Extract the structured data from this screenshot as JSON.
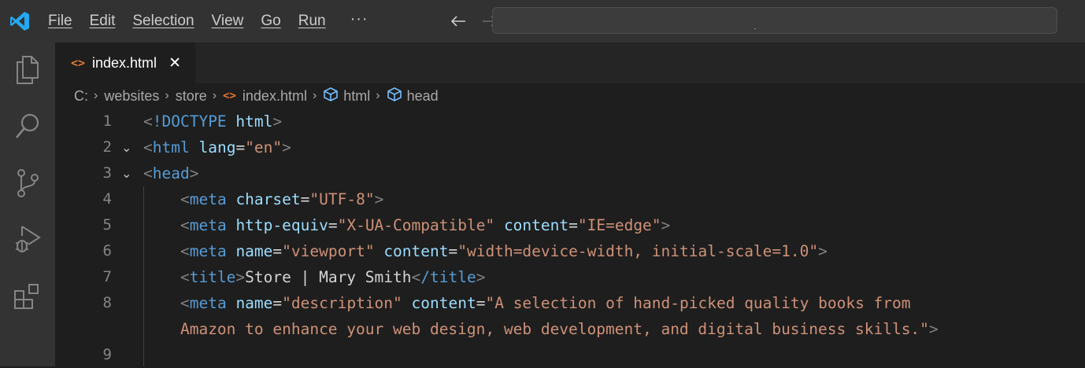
{
  "menu": {
    "items": [
      "File",
      "Edit",
      "Selection",
      "View",
      "Go",
      "Run"
    ],
    "more": "···"
  },
  "tab": {
    "label": "index.html",
    "icon": "<>",
    "close": "✕"
  },
  "breadcrumb": {
    "drive": "C:",
    "folder1": "websites",
    "folder2": "store",
    "file": "index.html",
    "symbol1": "html",
    "symbol2": "head"
  },
  "editor": {
    "line_numbers": [
      "1",
      "2",
      "3",
      "4",
      "5",
      "6",
      "7",
      "8",
      "9"
    ],
    "lines": {
      "l1": {
        "doctype": "!DOCTYPE",
        "html": "html"
      },
      "l2": {
        "tag": "html",
        "attr": "lang",
        "value": "\"en\""
      },
      "l3": {
        "tag": "head"
      },
      "l4": {
        "tag": "meta",
        "attr": "charset",
        "value": "\"UTF-8\""
      },
      "l5": {
        "tag": "meta",
        "attr1": "http-equiv",
        "value1": "\"X-UA-Compatible\"",
        "attr2": "content",
        "value2": "\"IE=edge\""
      },
      "l6": {
        "tag": "meta",
        "attr1": "name",
        "value1": "\"viewport\"",
        "attr2": "content",
        "value2": "\"width=device-width, initial-scale=1.0\""
      },
      "l7": {
        "tag": "title",
        "text": "Store | Mary Smith",
        "close_tag": "/title"
      },
      "l8": {
        "tag": "meta",
        "attr1": "name",
        "value1": "\"description\"",
        "attr2": "content",
        "value2a": "\"A selection of hand-picked quality books from",
        "value2b": "Amazon to enhance your web design, web development, and digital business skills.\""
      }
    }
  },
  "colors": {
    "tag": "#569cd6",
    "attribute": "#9cdcfe",
    "string": "#ce9178",
    "punctuation": "#808080",
    "accent_logo": "#23a9f2"
  }
}
